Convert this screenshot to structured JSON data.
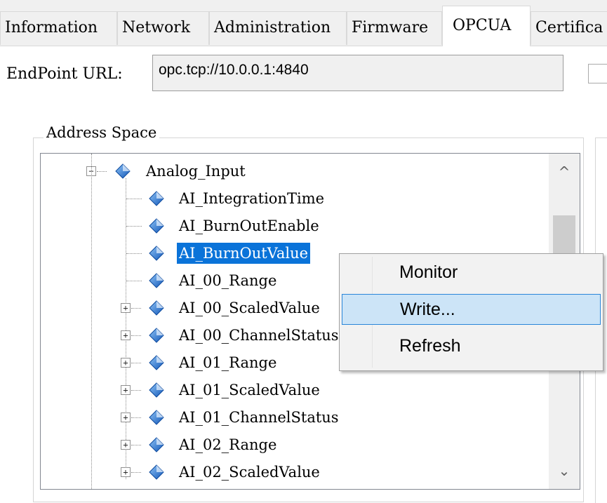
{
  "tabs": [
    "Information",
    "Network",
    "Administration",
    "Firmware",
    "OPCUA",
    "Certifica"
  ],
  "active_tab": "OPCUA",
  "endpoint": {
    "label": "EndPoint URL:",
    "value": "opc.tcp://10.0.0.1:4840"
  },
  "address_space": {
    "title": "Address Space",
    "root": {
      "label": "Analog_Input",
      "expander": "−"
    },
    "items": [
      {
        "label": "AI_IntegrationTime",
        "expander": ""
      },
      {
        "label": "AI_BurnOutEnable",
        "expander": ""
      },
      {
        "label": "AI_BurnOutValue",
        "expander": "",
        "selected": true
      },
      {
        "label": "AI_00_Range",
        "expander": ""
      },
      {
        "label": "AI_00_ScaledValue",
        "expander": "+"
      },
      {
        "label": "AI_00_ChannelStatus",
        "expander": "+"
      },
      {
        "label": "AI_01_Range",
        "expander": "+"
      },
      {
        "label": "AI_01_ScaledValue",
        "expander": "+"
      },
      {
        "label": "AI_01_ChannelStatus",
        "expander": "+"
      },
      {
        "label": "AI_02_Range",
        "expander": "+"
      },
      {
        "label": "AI_02_ScaledValue",
        "expander": "+"
      }
    ]
  },
  "scrollbar": {
    "up_glyph": "^",
    "down_glyph": "⌄",
    "position": 0.28
  },
  "context_menu": {
    "items": [
      "Monitor",
      "Write...",
      "Refresh"
    ],
    "highlighted": "Write..."
  },
  "icon": "variable-node-icon",
  "colors": {
    "selection": "#0a73d9",
    "node_icon": "#1f6fd1",
    "menu_highlight": "#cce4f7"
  }
}
